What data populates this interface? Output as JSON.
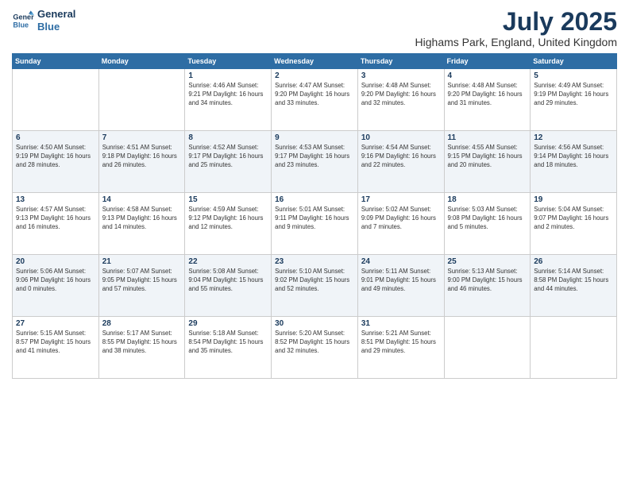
{
  "logo": {
    "line1": "General",
    "line2": "Blue"
  },
  "title": "July 2025",
  "subtitle": "Highams Park, England, United Kingdom",
  "days_header": [
    "Sunday",
    "Monday",
    "Tuesday",
    "Wednesday",
    "Thursday",
    "Friday",
    "Saturday"
  ],
  "weeks": [
    [
      {
        "day": "",
        "info": ""
      },
      {
        "day": "",
        "info": ""
      },
      {
        "day": "1",
        "info": "Sunrise: 4:46 AM\nSunset: 9:21 PM\nDaylight: 16 hours\nand 34 minutes."
      },
      {
        "day": "2",
        "info": "Sunrise: 4:47 AM\nSunset: 9:20 PM\nDaylight: 16 hours\nand 33 minutes."
      },
      {
        "day": "3",
        "info": "Sunrise: 4:48 AM\nSunset: 9:20 PM\nDaylight: 16 hours\nand 32 minutes."
      },
      {
        "day": "4",
        "info": "Sunrise: 4:48 AM\nSunset: 9:20 PM\nDaylight: 16 hours\nand 31 minutes."
      },
      {
        "day": "5",
        "info": "Sunrise: 4:49 AM\nSunset: 9:19 PM\nDaylight: 16 hours\nand 29 minutes."
      }
    ],
    [
      {
        "day": "6",
        "info": "Sunrise: 4:50 AM\nSunset: 9:19 PM\nDaylight: 16 hours\nand 28 minutes."
      },
      {
        "day": "7",
        "info": "Sunrise: 4:51 AM\nSunset: 9:18 PM\nDaylight: 16 hours\nand 26 minutes."
      },
      {
        "day": "8",
        "info": "Sunrise: 4:52 AM\nSunset: 9:17 PM\nDaylight: 16 hours\nand 25 minutes."
      },
      {
        "day": "9",
        "info": "Sunrise: 4:53 AM\nSunset: 9:17 PM\nDaylight: 16 hours\nand 23 minutes."
      },
      {
        "day": "10",
        "info": "Sunrise: 4:54 AM\nSunset: 9:16 PM\nDaylight: 16 hours\nand 22 minutes."
      },
      {
        "day": "11",
        "info": "Sunrise: 4:55 AM\nSunset: 9:15 PM\nDaylight: 16 hours\nand 20 minutes."
      },
      {
        "day": "12",
        "info": "Sunrise: 4:56 AM\nSunset: 9:14 PM\nDaylight: 16 hours\nand 18 minutes."
      }
    ],
    [
      {
        "day": "13",
        "info": "Sunrise: 4:57 AM\nSunset: 9:13 PM\nDaylight: 16 hours\nand 16 minutes."
      },
      {
        "day": "14",
        "info": "Sunrise: 4:58 AM\nSunset: 9:13 PM\nDaylight: 16 hours\nand 14 minutes."
      },
      {
        "day": "15",
        "info": "Sunrise: 4:59 AM\nSunset: 9:12 PM\nDaylight: 16 hours\nand 12 minutes."
      },
      {
        "day": "16",
        "info": "Sunrise: 5:01 AM\nSunset: 9:11 PM\nDaylight: 16 hours\nand 9 minutes."
      },
      {
        "day": "17",
        "info": "Sunrise: 5:02 AM\nSunset: 9:09 PM\nDaylight: 16 hours\nand 7 minutes."
      },
      {
        "day": "18",
        "info": "Sunrise: 5:03 AM\nSunset: 9:08 PM\nDaylight: 16 hours\nand 5 minutes."
      },
      {
        "day": "19",
        "info": "Sunrise: 5:04 AM\nSunset: 9:07 PM\nDaylight: 16 hours\nand 2 minutes."
      }
    ],
    [
      {
        "day": "20",
        "info": "Sunrise: 5:06 AM\nSunset: 9:06 PM\nDaylight: 16 hours\nand 0 minutes."
      },
      {
        "day": "21",
        "info": "Sunrise: 5:07 AM\nSunset: 9:05 PM\nDaylight: 15 hours\nand 57 minutes."
      },
      {
        "day": "22",
        "info": "Sunrise: 5:08 AM\nSunset: 9:04 PM\nDaylight: 15 hours\nand 55 minutes."
      },
      {
        "day": "23",
        "info": "Sunrise: 5:10 AM\nSunset: 9:02 PM\nDaylight: 15 hours\nand 52 minutes."
      },
      {
        "day": "24",
        "info": "Sunrise: 5:11 AM\nSunset: 9:01 PM\nDaylight: 15 hours\nand 49 minutes."
      },
      {
        "day": "25",
        "info": "Sunrise: 5:13 AM\nSunset: 9:00 PM\nDaylight: 15 hours\nand 46 minutes."
      },
      {
        "day": "26",
        "info": "Sunrise: 5:14 AM\nSunset: 8:58 PM\nDaylight: 15 hours\nand 44 minutes."
      }
    ],
    [
      {
        "day": "27",
        "info": "Sunrise: 5:15 AM\nSunset: 8:57 PM\nDaylight: 15 hours\nand 41 minutes."
      },
      {
        "day": "28",
        "info": "Sunrise: 5:17 AM\nSunset: 8:55 PM\nDaylight: 15 hours\nand 38 minutes."
      },
      {
        "day": "29",
        "info": "Sunrise: 5:18 AM\nSunset: 8:54 PM\nDaylight: 15 hours\nand 35 minutes."
      },
      {
        "day": "30",
        "info": "Sunrise: 5:20 AM\nSunset: 8:52 PM\nDaylight: 15 hours\nand 32 minutes."
      },
      {
        "day": "31",
        "info": "Sunrise: 5:21 AM\nSunset: 8:51 PM\nDaylight: 15 hours\nand 29 minutes."
      },
      {
        "day": "",
        "info": ""
      },
      {
        "day": "",
        "info": ""
      }
    ]
  ]
}
